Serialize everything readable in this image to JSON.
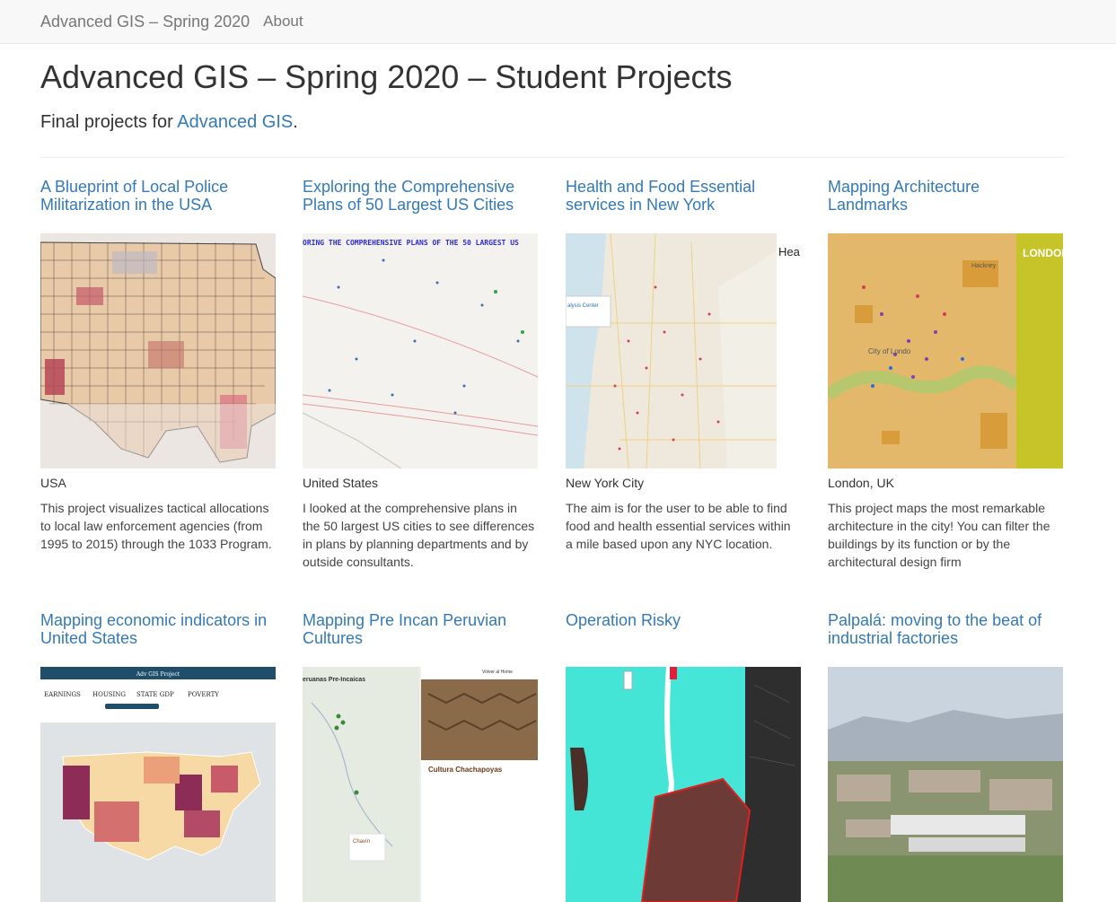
{
  "navbar": {
    "brand": "Advanced GIS – Spring 2020",
    "about": "About"
  },
  "header": {
    "title": "Advanced GIS – Spring 2020 – Student Projects",
    "lead_prefix": "Final projects for ",
    "lead_link": "Advanced GIS",
    "lead_suffix": "."
  },
  "projects": [
    {
      "title": "A Blueprint of Local Police Militarization in the USA",
      "location": "USA",
      "description": "This project visualizes tactical allocations to local law enforcement agencies (from 1995 to 2015) through the 1033 Program."
    },
    {
      "title": "Exploring the Comprehensive Plans of 50 Largest US Cities",
      "location": "United States",
      "description": "I looked at the comprehensive plans in the 50 largest US cities to see differences in plans by planning departments and by outside consultants.",
      "thumb_text": "ORING THE COMPREHENSIVE PLANS OF THE 50 LARGEST US"
    },
    {
      "title": "Health and Food Essential services in New York",
      "location": "New York City",
      "description": "The aim is for the user to be able to find food and health essential services within a mile based upon any NYC location.",
      "thumb_text": "Hea Esse New",
      "popup_text": "alysis Center"
    },
    {
      "title": "Mapping Architecture Landmarks",
      "location": "London, UK",
      "description": "This project maps the most remarkable architecture in the city! You can filter the buildings by its function or by the architectural design firm",
      "thumb_text": "LONDON Architect",
      "map_label": "City of Londo",
      "hackney": "Hackney"
    },
    {
      "title": "Mapping economic indicators in United States",
      "tabs": [
        "EARNINGS",
        "HOUSING",
        "STATE GDP",
        "POVERTY"
      ],
      "thumb_header": "Adv GIS Project"
    },
    {
      "title": "Mapping Pre Incan Peruvian Cultures",
      "thumb_text": "Cultura Chachapoyas",
      "side_title": "eruanas Pre-Incaicas",
      "back": "Volver al Home",
      "chip": "Chavín"
    },
    {
      "title": "Operation Risky"
    },
    {
      "title": "Palpalá: moving to the beat of industrial factories"
    }
  ],
  "colors": {
    "link": "#337ab7",
    "navbar_bg": "#f8f8f8"
  }
}
